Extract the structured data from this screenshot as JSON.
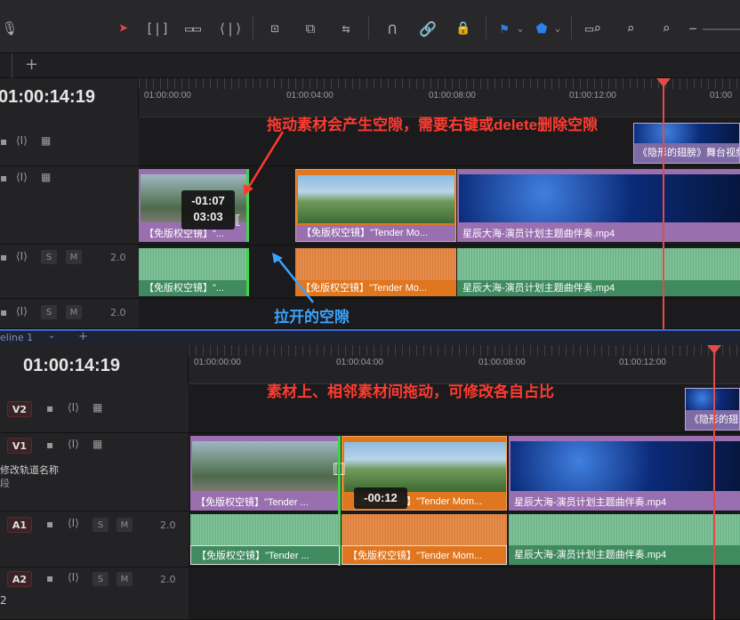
{
  "toolbar": {
    "icons": [
      "microphone-icon",
      "selection-arrow-icon",
      "trim-edit-icon",
      "dynamic-trim-icon",
      "blade-icon",
      "insert-clip-icon",
      "overwrite-clip-icon",
      "replace-clip-icon",
      "snapping-icon",
      "linked-selection-icon",
      "position-lock-icon",
      "flag-icon",
      "marker-icon",
      "zoom-full-icon",
      "zoom-detail-icon",
      "zoom-custom-icon",
      "zoom-out-icon"
    ]
  },
  "top": {
    "timecode": "01:00:14:19",
    "ruler_labels": [
      "01:00:00:00",
      "01:00:04:00",
      "01:00:08:00",
      "01:00:12:00",
      "01:00"
    ],
    "tracks": {
      "a1_volume": "2.0",
      "a2_volume": "2.0",
      "solo": "S",
      "mute": "M"
    },
    "clips": {
      "v1_clip1_label": "【免版权空镜】\"...",
      "v1_clip2_label": "【免版权空镜】\"Tender Mo...",
      "v1_clip3_label": "星辰大海-演员计划主题曲伴奏.mp4",
      "v2_clip_label": "《隐形的翅膀》舞台视频",
      "a1_clip1_label": "【免版权空镜】\"...",
      "a1_clip2_label": "【免版权空镜】\"Tender Mo...",
      "a1_clip3_label": "星辰大海-演员计划主题曲伴奏.mp4"
    },
    "tooltip_line1": "-01:07",
    "tooltip_line2": "03:03",
    "annotation_red": "拖动素材会产生空隙，需要右键或delete删除空隙",
    "annotation_blue": "拉开的空隙"
  },
  "bottom": {
    "tab_label": "eline 1",
    "timecode": "01:00:14:19",
    "ruler_labels": [
      "01:00:00:00",
      "01:00:04:00",
      "01:00:08:00",
      "01:00:12:00"
    ],
    "track_names": {
      "v2": "V2",
      "v1": "V1",
      "a1": "A1",
      "a2": "A2"
    },
    "track_hint_line1": "修改轨道名称",
    "track_hint_line2": "段",
    "a2_number": "2",
    "volume": "2.0",
    "solo": "S",
    "mute": "M",
    "clips": {
      "v2_clip_label": "《隐形的翅",
      "v1_clip1_label": "【免版权空镜】\"Tender ...",
      "v1_clip2_label": "【免版权空镜】\"Tender Mom...",
      "v1_clip3_label": "星辰大海-演员计划主题曲伴奏.mp4",
      "a1_clip1_label": "【免版权空镜】\"Tender ...",
      "a1_clip2_label": "【免版权空镜】\"Tender Mom...",
      "a1_clip3_label": "星辰大海-演员计划主题曲伴奏.mp4"
    },
    "tooltip": "-00:12",
    "annotation_red": "素材上、相邻素材间拖动，可修改各自占比"
  },
  "colors": {
    "playhead": "#e24b4b",
    "video_clip": "#9a6fb0",
    "audio_clip": "#3f8a5e",
    "selected_clip": "#e0761e",
    "annotation_red": "#ff3b30",
    "annotation_blue": "#3aa3ff"
  }
}
